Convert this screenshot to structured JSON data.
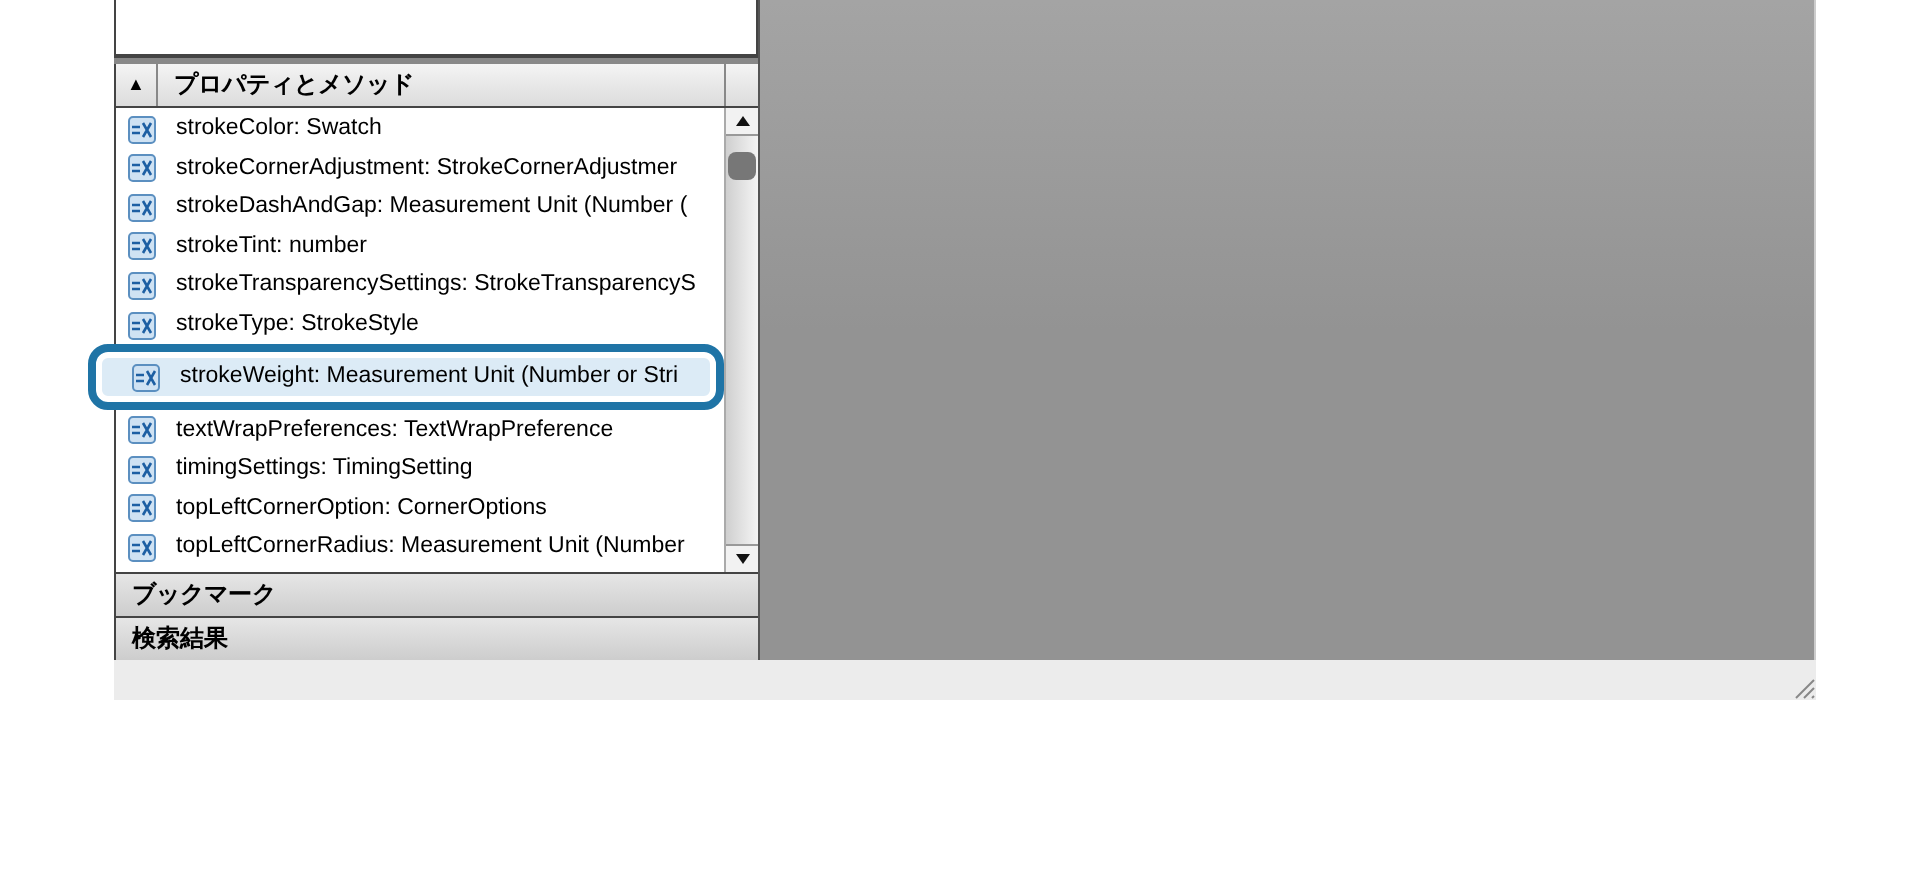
{
  "panel": {
    "sort_button": "▲",
    "column_header": "プロパティとメソッド",
    "items": [
      {
        "text": "strokeColor: Swatch",
        "selected": false
      },
      {
        "text": "strokeCornerAdjustment: StrokeCornerAdjustmer",
        "selected": false
      },
      {
        "text": "strokeDashAndGap: Measurement Unit (Number (",
        "selected": false
      },
      {
        "text": "strokeTint: number",
        "selected": false
      },
      {
        "text": "strokeTransparencySettings: StrokeTransparencyS",
        "selected": false
      },
      {
        "text": "strokeType: StrokeStyle",
        "selected": false
      },
      {
        "text": "strokeWeight: Measurement Unit (Number or Stri",
        "selected": true
      },
      {
        "text": "textWrapPreferences: TextWrapPreference",
        "selected": false
      },
      {
        "text": "timingSettings: TimingSetting",
        "selected": false
      },
      {
        "text": "topLeftCornerOption: CornerOptions",
        "selected": false
      },
      {
        "text": "topLeftCornerRadius: Measurement Unit (Number",
        "selected": false
      }
    ],
    "sections": [
      "ブックマーク",
      "検索結果"
    ]
  }
}
